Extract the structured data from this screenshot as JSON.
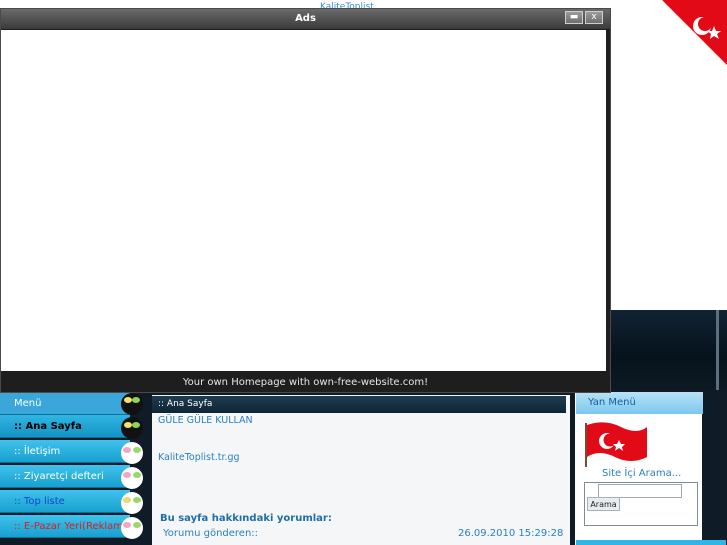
{
  "top": {
    "site_link": "KaliteToplist"
  },
  "ads_window": {
    "title": "Ads",
    "minimize_label": "▬",
    "close_label": "x",
    "footer": "Your own Homepage with own-free-website.com!"
  },
  "left_menu": {
    "header": "Menü",
    "items": [
      {
        "label": ":: Ana Sayfa"
      },
      {
        "label": ":: İletişim"
      },
      {
        "label": ":: Ziyaretçi defteri"
      },
      {
        "label": ":: Top liste"
      },
      {
        "label": ":: E-Pazar Yeri(Reklam)"
      }
    ]
  },
  "content": {
    "header": ":: Ana Sayfa",
    "line1": "GÜLE GÜLE KULLAN",
    "line2": "KaliteToplist.tr.gg",
    "comments_title": "Bu sayfa hakkındaki yorumlar:",
    "comment_sender": "Yorumu gönderen::",
    "comment_date": "26.09.2010 15:29:28"
  },
  "right_panel": {
    "header": "Yan Menü",
    "search_title": "Site İçi Arama...",
    "search_button": "Arama",
    "search_value": ""
  },
  "colors": {
    "accent": "#2fb5e6",
    "flag_red": "#e30a17",
    "link_blue": "#2a7fc4"
  }
}
